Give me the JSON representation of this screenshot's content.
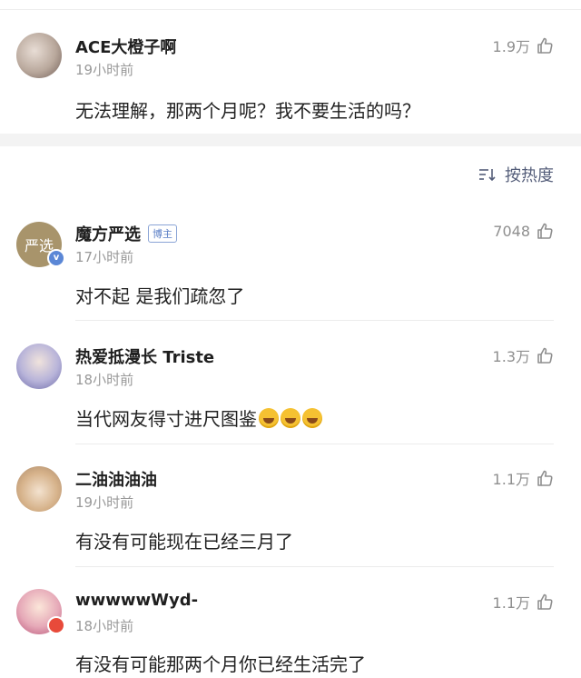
{
  "sort": {
    "label": "按热度",
    "icon": "sort-icon"
  },
  "comments": [
    {
      "username": "ACE大橙子啊",
      "time": "19小时前",
      "text": "无法理解，那两个月呢？我不要生活的吗？",
      "likes": "1.9万",
      "avatar_color": "#cfc1b7"
    },
    {
      "username": "魔方严选",
      "badge": "博主",
      "time": "17小时前",
      "text": "对不起 是我们疏忽了",
      "likes": "7048",
      "avatar_text": "严选",
      "avatar_color": "#a8946b"
    },
    {
      "username": "热爱抵漫长 Triste",
      "time": "18小时前",
      "text": "当代网友得寸进尺图鉴",
      "emoji_count": 3,
      "likes": "1.3万",
      "avatar_color": "#b7b3d9"
    },
    {
      "username": "二油油油油",
      "time": "19小时前",
      "text": "有没有可能现在已经三月了",
      "likes": "1.1万",
      "avatar_color": "#d6b28a"
    },
    {
      "username": "wwwwwWyd-",
      "time": "18小时前",
      "text": "有没有可能那两个月你已经生活完了",
      "likes": "1.1万",
      "avatar_color": "#e6a9b8"
    }
  ]
}
